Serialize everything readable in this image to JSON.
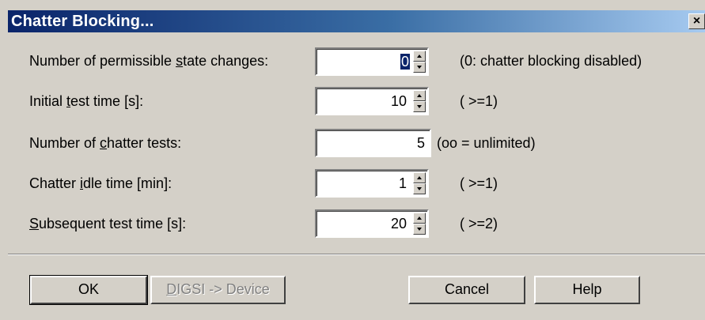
{
  "window": {
    "title": "Chatter Blocking...",
    "close_glyph": "×"
  },
  "fields": [
    {
      "label_pre": "Number of permissible ",
      "label_u": "s",
      "label_post": "tate changes:",
      "value": "0",
      "hint": "(0: chatter blocking disabled)"
    },
    {
      "label_pre": "Initial ",
      "label_u": "t",
      "label_post": "est time [s]:",
      "value": "10",
      "hint": "( >=1)"
    },
    {
      "label_pre": "Number of ",
      "label_u": "c",
      "label_post": "hatter tests:",
      "value": "5",
      "hint": "(oo = unlimited)"
    },
    {
      "label_pre": "Chatter ",
      "label_u": "i",
      "label_post": "dle time [min]:",
      "value": "1",
      "hint": "( >=1)"
    },
    {
      "label_pre": "",
      "label_u": "S",
      "label_post": "ubsequent test time [s]:",
      "value": "20",
      "hint": "( >=2)"
    }
  ],
  "buttons": {
    "ok": "OK",
    "digsi_u": "D",
    "digsi_rest": "IGSI -> Device",
    "cancel": "Cancel",
    "help": "Help"
  },
  "icons": {
    "close": "close-icon",
    "spin_up": "spin-up-icon",
    "spin_down": "spin-down-icon"
  }
}
